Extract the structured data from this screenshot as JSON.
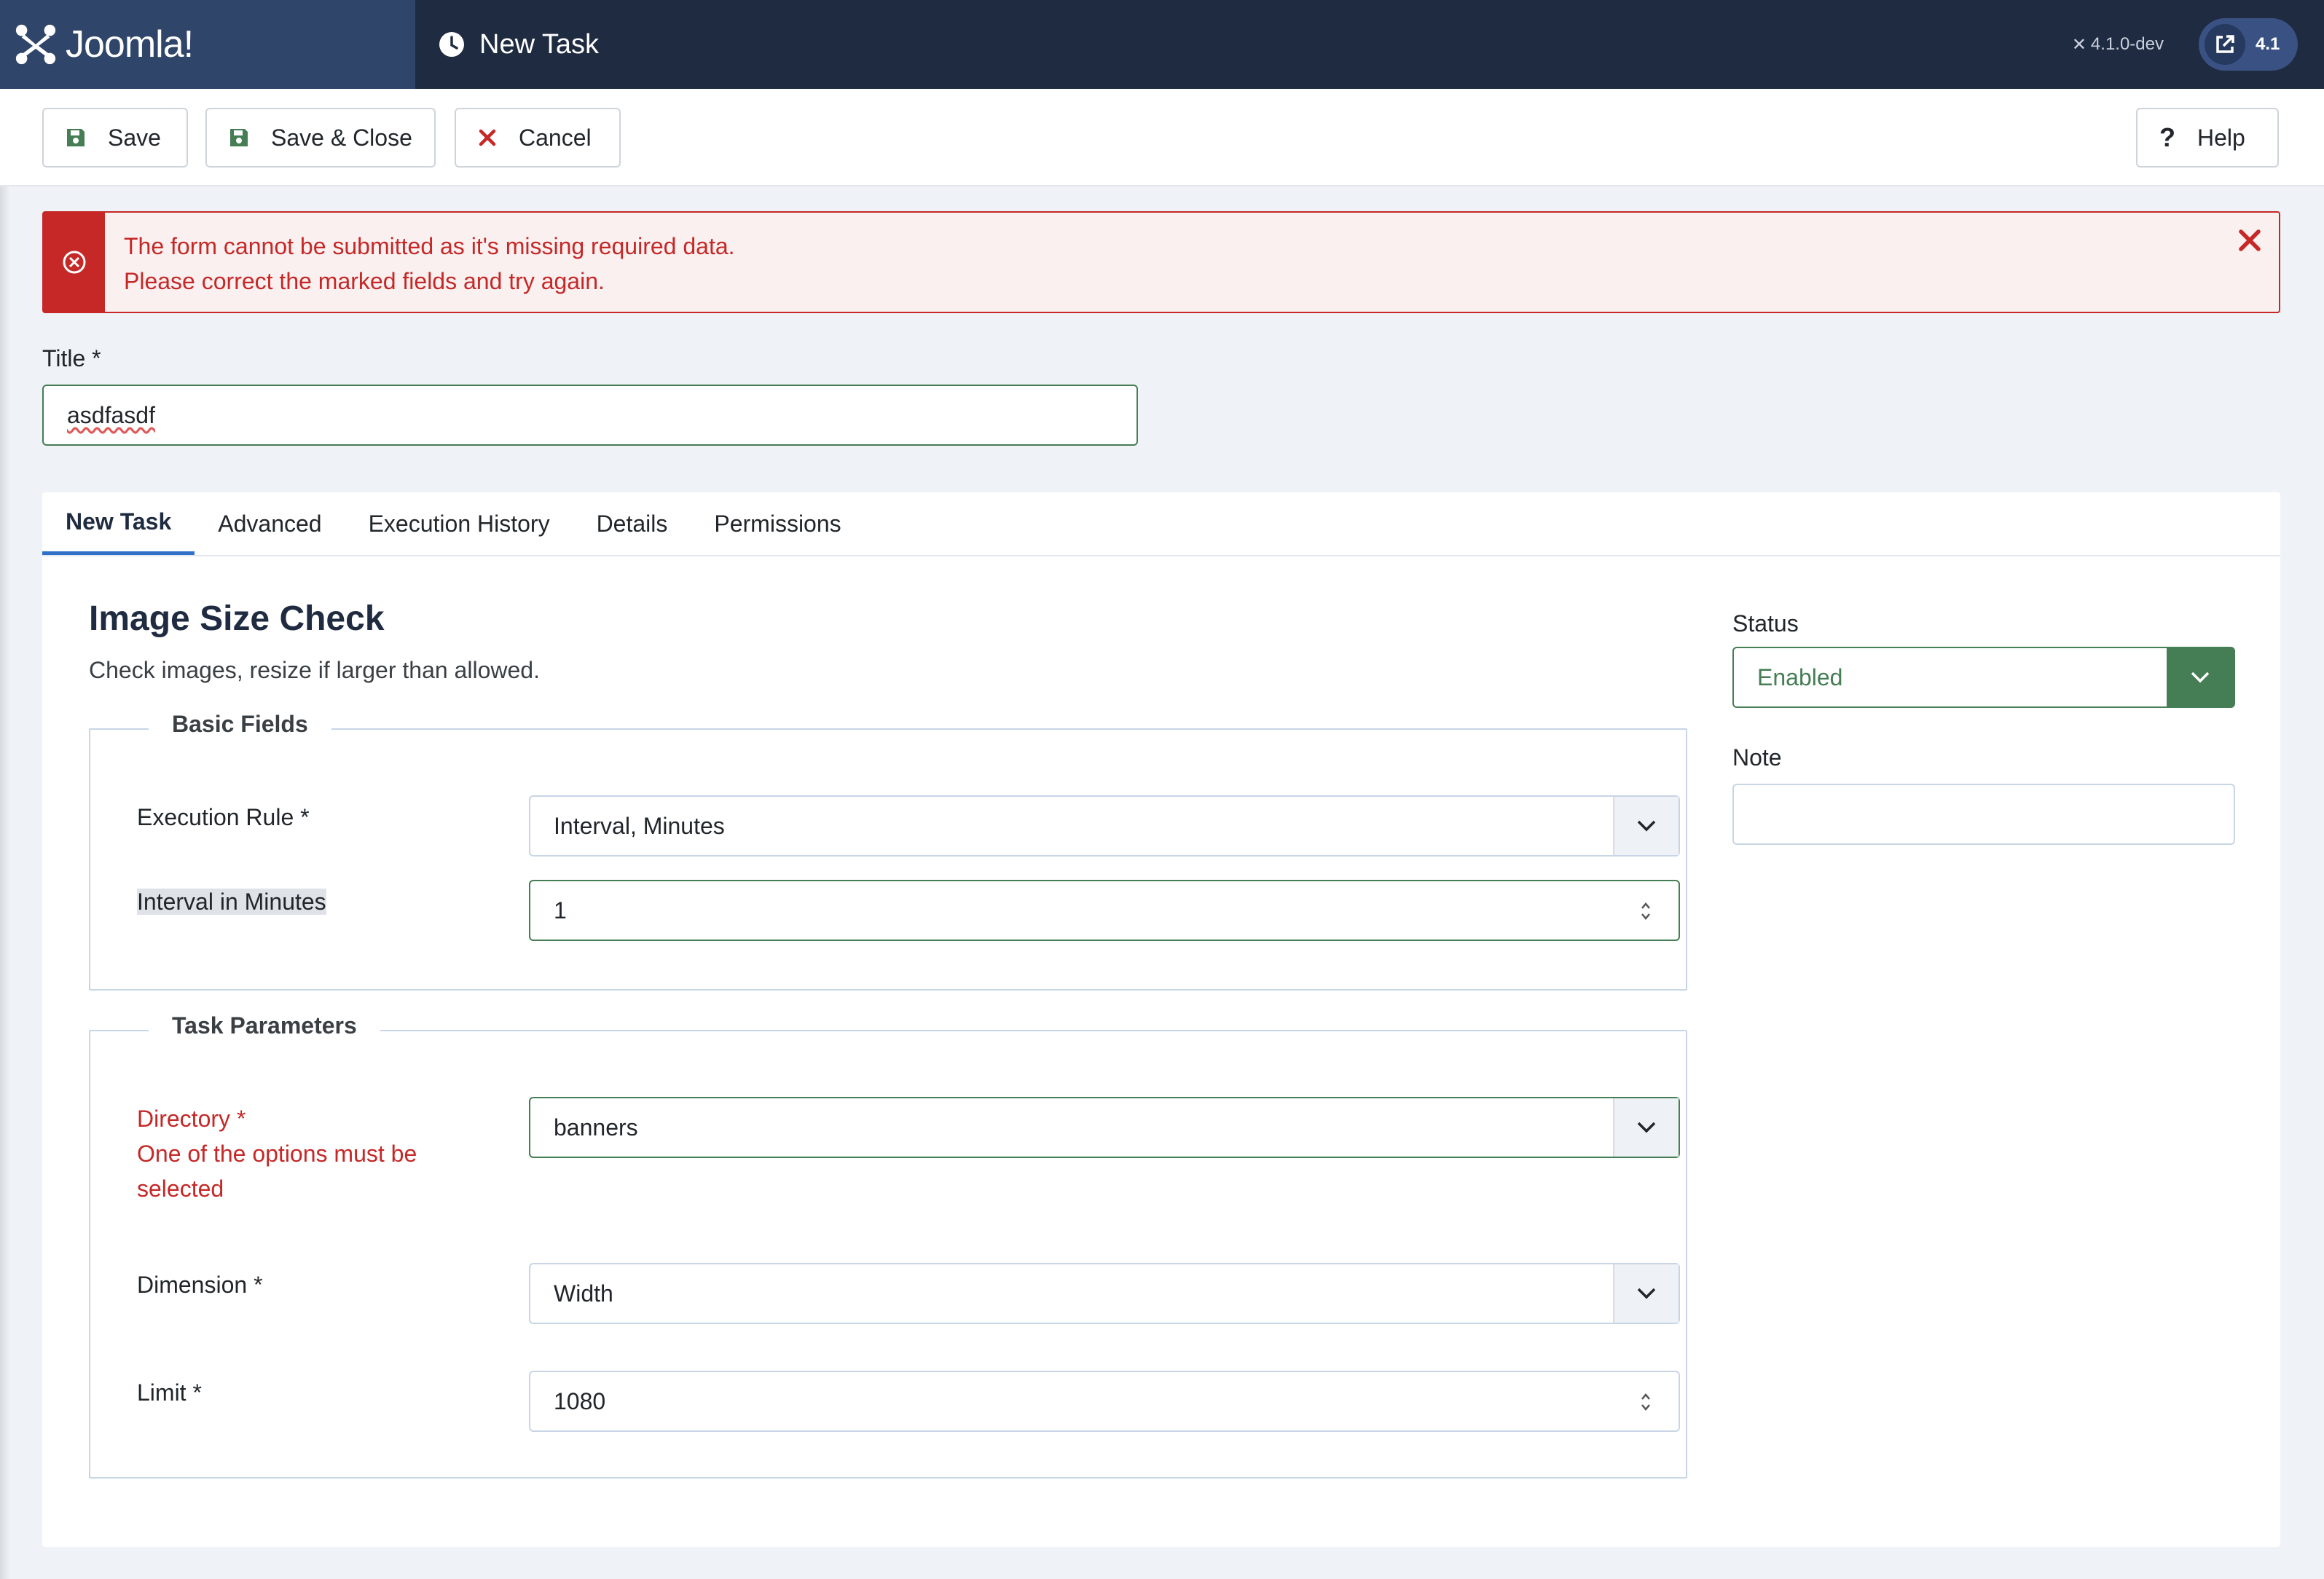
{
  "app": {
    "brand": "Joomla!",
    "page_title": "New Task",
    "version_text": "4.1.0-dev",
    "version_badge": "4.1"
  },
  "toolbar": {
    "save": "Save",
    "save_close": "Save & Close",
    "cancel": "Cancel",
    "help": "Help"
  },
  "alert": {
    "line1": "The form cannot be submitted as it's missing required data.",
    "line2": "Please correct the marked fields and try again."
  },
  "form": {
    "title_label": "Title *",
    "title_value": "asdfasdf"
  },
  "tabs": [
    "New Task",
    "Advanced",
    "Execution History",
    "Details",
    "Permissions"
  ],
  "task": {
    "heading": "Image Size Check",
    "description": "Check images, resize if larger than allowed."
  },
  "basic_fields": {
    "legend": "Basic Fields",
    "execution_rule_label": "Execution Rule *",
    "execution_rule_value": "Interval, Minutes",
    "interval_label": "Interval in Minutes",
    "interval_value": "1"
  },
  "task_parameters": {
    "legend": "Task Parameters",
    "directory_label": "Directory *",
    "directory_error": "One of the options must be selected",
    "directory_error_l1": "One of the options must be",
    "directory_error_l2": "selected",
    "directory_value": "banners",
    "dimension_label": "Dimension *",
    "dimension_value": "Width",
    "limit_label": "Limit *",
    "limit_value": "1080"
  },
  "side": {
    "status_label": "Status",
    "status_value": "Enabled",
    "note_label": "Note",
    "note_value": ""
  },
  "colors": {
    "header": "#1f2b40",
    "logo_block": "#30456a",
    "success_green": "#457d54",
    "danger_red": "#c52827",
    "tab_active": "#3071c7"
  }
}
